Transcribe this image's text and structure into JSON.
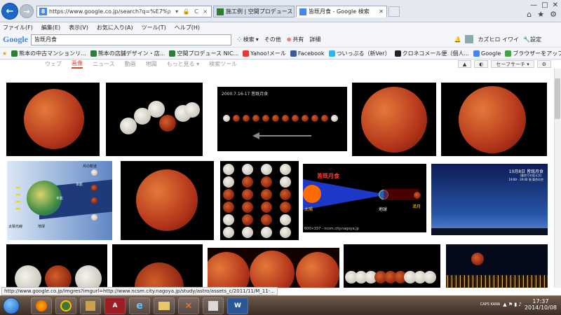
{
  "browser": {
    "url": "https://www.google.co.jp/search?q=%E7%9A%86%E6%97",
    "address_icons": "ρ ▾ 🔒 C ×",
    "tabs": [
      {
        "label": "施工例 | 空間プロデュース"
      },
      {
        "label": "皆既月食 - Google 検索"
      }
    ],
    "window_controls": [
      "—",
      "□",
      "✕"
    ],
    "tool_icons": [
      "⌂",
      "★",
      "⚙"
    ]
  },
  "menu": [
    "ファイル(F)",
    "編集(E)",
    "表示(V)",
    "お気に入り(A)",
    "ツール(T)",
    "ヘルプ(H)"
  ],
  "google_toolbar": {
    "logo": "Google",
    "query": "皆既月食",
    "search_label": "検索",
    "more_label": "その他",
    "share_label": "共有",
    "details_label": "詳細",
    "user": "カズヒロ イワイ",
    "settings_label": "設定"
  },
  "favorites": [
    {
      "label": "熊本の中古マンションリ...",
      "color": "#2e7d32"
    },
    {
      "label": "熊本の店舗デザイン・店...",
      "color": "#2e7d32"
    },
    {
      "label": "空間プロデュース NIC...",
      "color": "#2e7d32"
    },
    {
      "label": "Yahoo!メール",
      "color": "#e53935"
    },
    {
      "label": "Facebook",
      "color": "#3b5998"
    },
    {
      "label": "ついっぷる（新Ver）",
      "color": "#29b6f6"
    },
    {
      "label": "クロネコメール便（個人...",
      "color": "#222222"
    },
    {
      "label": "Google",
      "color": "#4285f4"
    },
    {
      "label": "ブラウザーをアップ...",
      "color": "#43a047"
    }
  ],
  "search_nav": {
    "tabs": [
      "ウェブ",
      "画像",
      "ニュース",
      "動画",
      "地図",
      "もっと見る ▾",
      "検索ツール"
    ],
    "active": "画像",
    "safe_search": "セーフサーチ ▾"
  },
  "images": {
    "diagram_caption": "600×337 - ncsm.city.nagoya.jp",
    "diagram_title": "皆既月食",
    "diagram_sun": "太陽",
    "diagram_earth": "地球",
    "diagram_moon": "満月",
    "sequence_title": "2000.7.16-17 皆既月食",
    "chart_title": "10月8日 皆既月食",
    "chart_sub": "（東京での見え方）",
    "chart_sub2": "19:00 - 19:40 頃 東京の空",
    "orbit_label": "月の軌道",
    "shadow_label": "本影",
    "penumbra_label": "半影",
    "sunlight_label": "太陽光線",
    "earth_label": "地球"
  },
  "status_url": "http://www.google.co.jp/imgres?imgurl=http://www.ncsm.city.nagoya.jp/study/astro/assets_c/2011/11/M_11-...",
  "taskbar": {
    "apps": [
      "",
      "",
      "",
      "A",
      "e",
      "",
      "",
      "",
      "W"
    ],
    "tray_text": "CAPS KANA",
    "time": "17:37",
    "date": "2014/10/08"
  }
}
